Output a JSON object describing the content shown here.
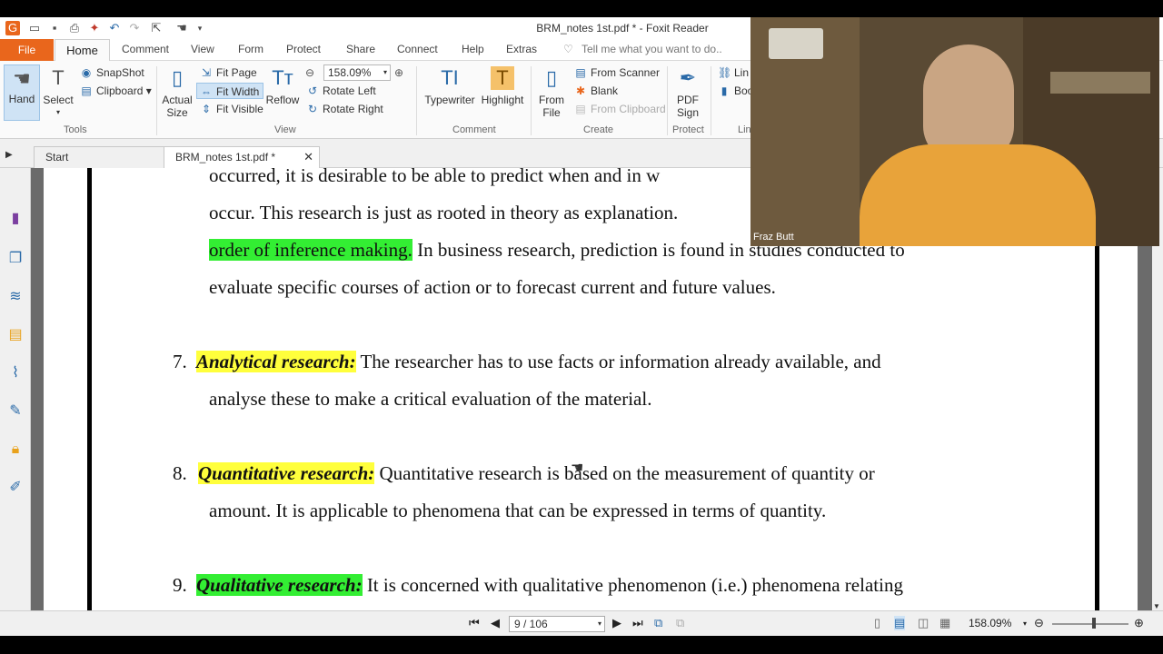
{
  "window": {
    "title": "BRM_notes 1st.pdf * - Foxit Reader"
  },
  "menu": {
    "file": "File",
    "home": "Home",
    "comment": "Comment",
    "view": "View",
    "form": "Form",
    "protect": "Protect",
    "share": "Share",
    "connect": "Connect",
    "help": "Help",
    "extras": "Extras",
    "tell_me": "Tell me what you want to do.."
  },
  "ribbon": {
    "hand": "Hand",
    "select": "Select",
    "snapshot": "SnapShot",
    "clipboard": "Clipboard",
    "tools_group": "Tools",
    "actual_size": "Actual Size",
    "fit_page": "Fit Page",
    "fit_width": "Fit Width",
    "fit_visible": "Fit Visible",
    "reflow": "Reflow",
    "zoom": "158.09%",
    "rotate_left": "Rotate Left",
    "rotate_right": "Rotate Right",
    "view_group": "View",
    "typewriter": "Typewriter",
    "highlight": "Highlight",
    "comment_group": "Comment",
    "from_file": "From File",
    "from_scanner": "From Scanner",
    "blank": "Blank",
    "from_clipboard": "From Clipboard",
    "create_group": "Create",
    "pdf_sign": "PDF Sign",
    "protect_group": "Protect",
    "link": "Lin",
    "bookmark": "Boo",
    "links_group": "Lin"
  },
  "tabs": [
    {
      "label": "Start"
    },
    {
      "label": "BRM_notes 1st.pdf *"
    }
  ],
  "document": {
    "line1": "occurred, it is desirable to be able to predict when and in w",
    "line2": "occur. This research is just as rooted in theory as explanation.",
    "line3_hl": "order of inference making.",
    "line3_rest": " In business research, prediction is found in studies conducted to",
    "line4": "evaluate specific courses of action or to forecast current and future values.",
    "item7_num": "7.",
    "item7_term": "Analytical research:",
    "item7_rest": " The researcher has to use facts or information already available, and",
    "item7_line2": "analyse these to make a critical evaluation of the material.",
    "item8_num": "8.",
    "item8_term": "Quantitative research:",
    "item8_rest": " Quantitative research is based on the measurement of quantity or",
    "item8_line2": "amount. It is applicable to phenomena that can be expressed in terms of quantity.",
    "item9_num": "9.",
    "item9_term": "Qualitative research:",
    "item9_rest": " It is concerned with qualitative phenomenon (i.e.) phenomena relating"
  },
  "status": {
    "page": "9 / 106",
    "zoom": "158.09%"
  },
  "webcam": {
    "name": "Fraz Butt"
  },
  "colors": {
    "accent": "#e9661c",
    "highlight_yellow": "#ffff3c",
    "highlight_green": "#33ee33"
  }
}
